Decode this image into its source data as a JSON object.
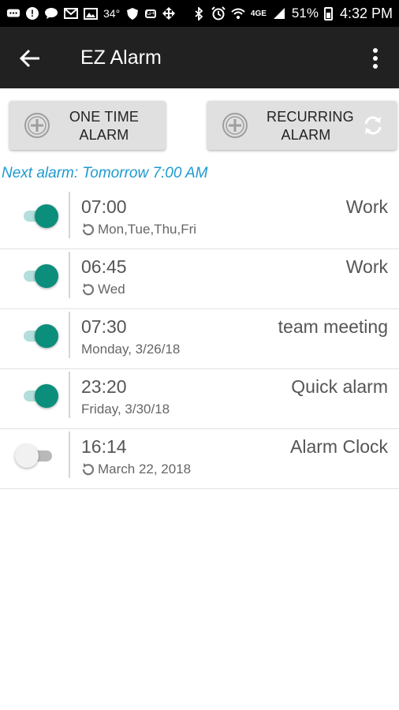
{
  "status_bar": {
    "temperature": "34°",
    "network": "4GE",
    "battery": "51%",
    "time": "4:32 PM",
    "icons": [
      "messaging-icon",
      "alert-icon",
      "chat-icon",
      "mail-icon",
      "photo-icon",
      "temperature-icon",
      "shield-icon",
      "google-plus-icon",
      "arrows-icon",
      "bluetooth-icon",
      "alarm-icon",
      "wifi-icon",
      "signal-icon",
      "battery-icon"
    ]
  },
  "toolbar": {
    "title": "EZ Alarm"
  },
  "buttons": {
    "one_time": {
      "line1": "ONE TIME",
      "line2": "ALARM"
    },
    "recurring": {
      "line1": "RECURRING",
      "line2": "ALARM"
    }
  },
  "next_alarm": "Next alarm: Tomorrow 7:00 AM",
  "alarms": [
    {
      "time": "07:00",
      "label": "Work",
      "schedule": "Mon,Tue,Thu,Fri",
      "recurring": true,
      "enabled": true
    },
    {
      "time": "06:45",
      "label": "Work",
      "schedule": "Wed",
      "recurring": true,
      "enabled": true
    },
    {
      "time": "07:30",
      "label": "team meeting",
      "schedule": "Monday, 3/26/18",
      "recurring": false,
      "enabled": true
    },
    {
      "time": "23:20",
      "label": "Quick alarm",
      "schedule": "Friday, 3/30/18",
      "recurring": false,
      "enabled": true
    },
    {
      "time": "16:14",
      "label": "Alarm Clock",
      "schedule": "March 22, 2018",
      "recurring": true,
      "enabled": false
    }
  ],
  "colors": {
    "accent": "#0b8f7c",
    "link": "#1e9ad0",
    "toolbar": "#212121"
  }
}
